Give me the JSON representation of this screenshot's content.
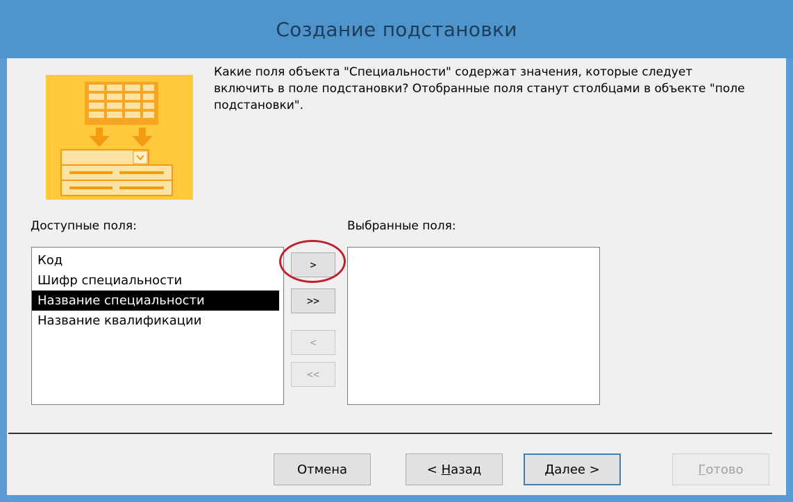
{
  "window": {
    "title": "Создание подстановки"
  },
  "description": "Какие поля объекта \"Специальности\" содержат значения, которые следует включить в поле подстановки? Отобранные поля станут столбцами в объекте \"поле подстановки\".",
  "available": {
    "label": "Доступные поля:",
    "items": [
      "Код",
      "Шифр специальности",
      "Название специальности",
      "Название квалификации"
    ],
    "selected": "Название специальности"
  },
  "selected_fields": {
    "label": "Выбранные поля:",
    "items": []
  },
  "move_buttons": {
    "add_one": ">",
    "add_all": ">>",
    "remove_one": "<",
    "remove_all": "<<"
  },
  "footer": {
    "cancel": "Отмена",
    "back_prefix": "< ",
    "back_hotkey": "Н",
    "back_rest": "азад",
    "next_hotkey": "Д",
    "next_rest": "алее >",
    "finish_hotkey": "Г",
    "finish_rest": "отово"
  },
  "colors": {
    "title_bar": "#4f95cc",
    "dialog_bg": "#f0f0f0",
    "highlight_circle": "#c0202b",
    "selection": "#000000"
  },
  "illustration": {
    "icon": "lookup-wizard-icon"
  }
}
